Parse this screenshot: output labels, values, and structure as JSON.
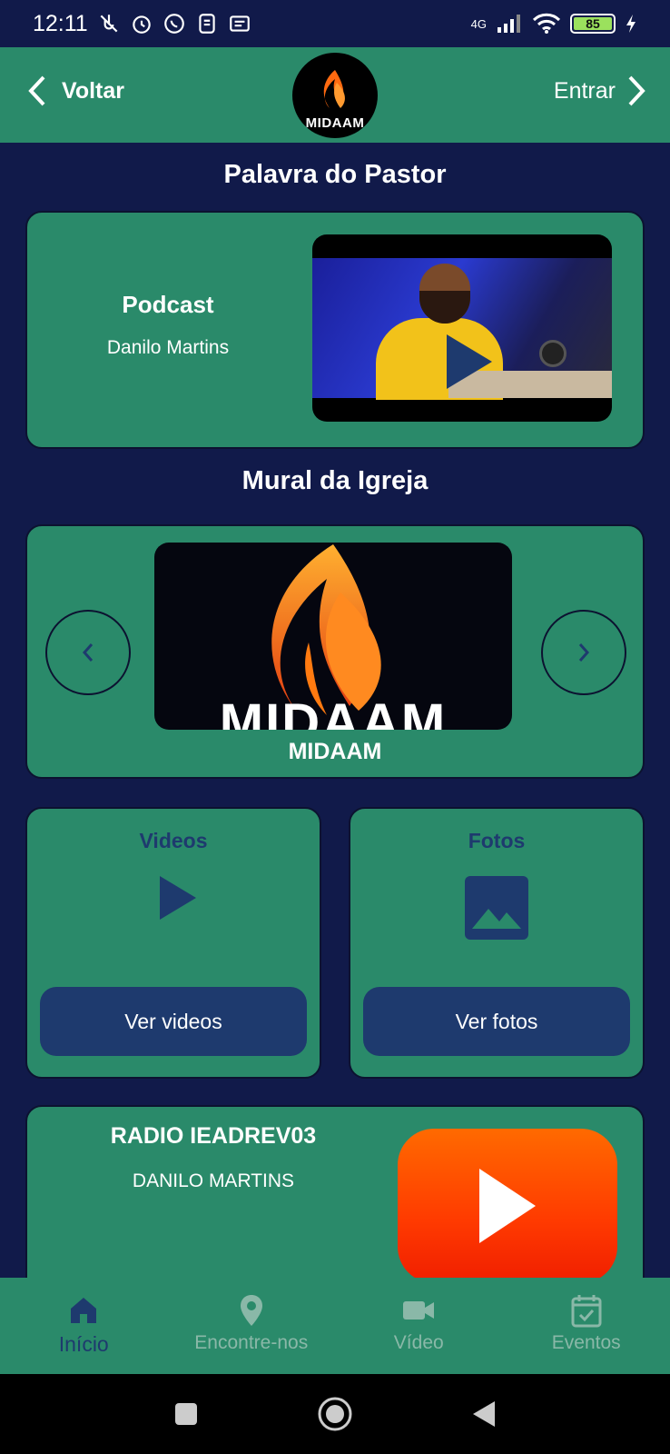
{
  "status_bar": {
    "time": "12:11",
    "network": "4G",
    "battery": "85"
  },
  "header": {
    "back_label": "Voltar",
    "enter_label": "Entrar",
    "logo_text": "MIDAAM"
  },
  "pastor_section": {
    "title": "Palavra do Pastor",
    "card_title": "Podcast",
    "card_author": "Danilo Martins"
  },
  "mural_section": {
    "title": "Mural da Igreja",
    "image_text": "MIDAAM",
    "caption": "MIDAAM"
  },
  "videos_card": {
    "title": "Videos",
    "button_label": "Ver videos"
  },
  "photos_card": {
    "title": "Fotos",
    "button_label": "Ver fotos"
  },
  "radio_card": {
    "title": "RADIO IEADREV03",
    "subtitle": "DANILO MARTINS"
  },
  "bottom_nav": {
    "items": [
      {
        "label": "Início",
        "icon": "home-icon",
        "active": true
      },
      {
        "label": "Encontre-nos",
        "icon": "location-pin-icon",
        "active": false
      },
      {
        "label": "Vídeo",
        "icon": "videocam-icon",
        "active": false
      },
      {
        "label": "Eventos",
        "icon": "calendar-check-icon",
        "active": false
      }
    ]
  },
  "colors": {
    "background": "#111a4a",
    "card": "#2a8a6a",
    "accent": "#1e3a6e",
    "youtube": "#ff3a00"
  }
}
